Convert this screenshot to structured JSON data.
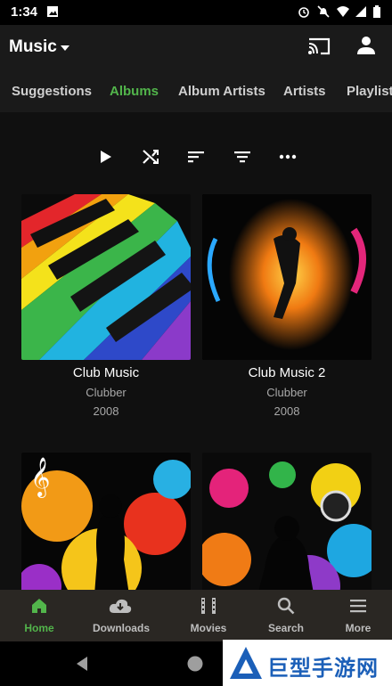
{
  "status_bar": {
    "time": "1:34"
  },
  "app_bar": {
    "title": "Music"
  },
  "tabs": [
    {
      "label": "Suggestions",
      "active": false
    },
    {
      "label": "Albums",
      "active": true
    },
    {
      "label": "Album Artists",
      "active": false
    },
    {
      "label": "Artists",
      "active": false
    },
    {
      "label": "Playlists",
      "active": false
    }
  ],
  "toolbar": [
    "play-icon",
    "shuffle-icon",
    "sort-icon",
    "filter-icon",
    "more-icon"
  ],
  "albums": [
    {
      "name": "Club Music",
      "artist": "Clubber",
      "year": "2008"
    },
    {
      "name": "Club Music 2",
      "artist": "Clubber",
      "year": "2008"
    },
    {
      "name": "",
      "artist": "",
      "year": ""
    },
    {
      "name": "",
      "artist": "",
      "year": ""
    }
  ],
  "bottom_nav": [
    {
      "label": "Home",
      "icon": "home-icon",
      "active": true
    },
    {
      "label": "Downloads",
      "icon": "download-icon",
      "active": false
    },
    {
      "label": "Movies",
      "icon": "film-icon",
      "active": false
    },
    {
      "label": "Search",
      "icon": "search-icon",
      "active": false
    },
    {
      "label": "More",
      "icon": "menu-icon",
      "active": false
    }
  ],
  "watermark": {
    "text": "巨型手游网"
  },
  "colors": {
    "accent": "#52b54b",
    "background": "#101010",
    "nav_bg": "#2a2723"
  }
}
